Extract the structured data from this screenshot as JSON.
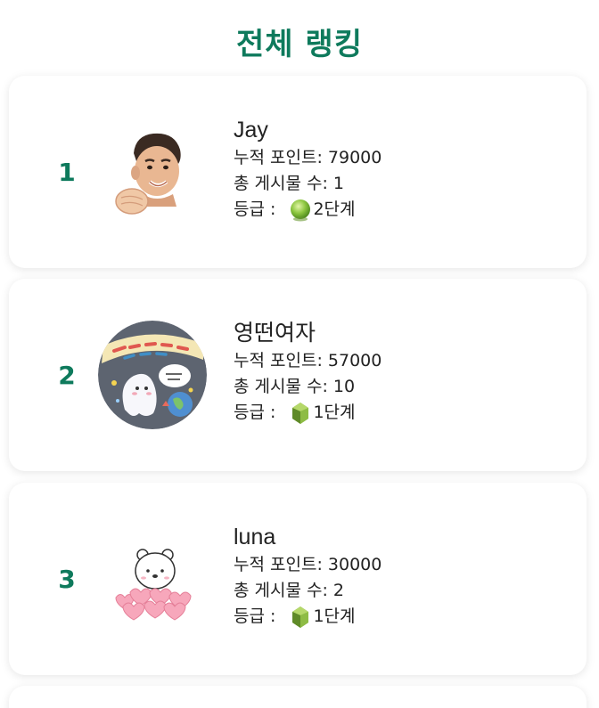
{
  "title": "전체 랭킹",
  "labels": {
    "points_prefix": "누적 포인트: ",
    "posts_prefix": "총 게시물 수: ",
    "grade_prefix": "등급 : "
  },
  "ranking": [
    {
      "rank": "1",
      "username": "Jay",
      "points": "79000",
      "posts": "1",
      "grade": "2단계",
      "grade_icon": "green-orb-icon",
      "avatar": "memoji-avatar"
    },
    {
      "rank": "2",
      "username": "영떤여자",
      "points": "57000",
      "posts": "10",
      "grade": "1단계",
      "grade_icon": "green-gem-icon",
      "avatar": "doodle-ghost-avatar"
    },
    {
      "rank": "3",
      "username": "luna",
      "points": "30000",
      "posts": "2",
      "grade": "1단계",
      "grade_icon": "green-gem-icon",
      "avatar": "bear-hearts-avatar"
    }
  ],
  "colors": {
    "accent": "#0e7a5c",
    "text": "#222222",
    "card_bg": "#ffffff"
  }
}
